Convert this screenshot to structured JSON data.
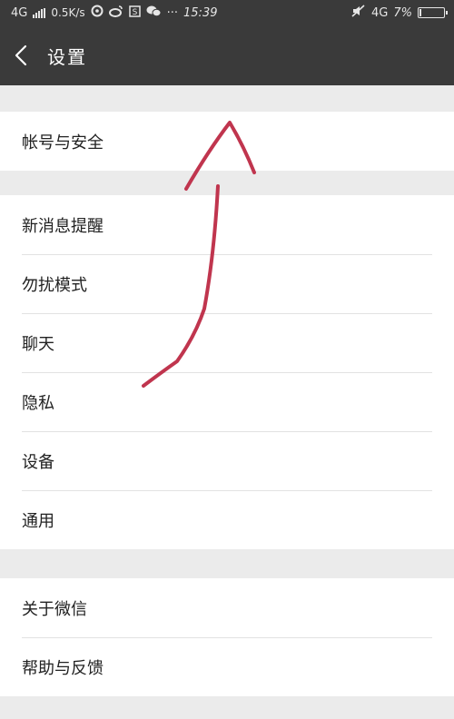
{
  "status_bar": {
    "network": "4G",
    "speed": "0.5K/s",
    "dots": "···",
    "time": "15:39",
    "network_right": "4G",
    "battery_text": "7%",
    "icons": [
      "signal-icon",
      "weibo-app-icon",
      "weibo-icon",
      "s-app-icon",
      "wechat-icon",
      "mute-icon",
      "battery-icon"
    ]
  },
  "header": {
    "title": "设置"
  },
  "groups": [
    {
      "items": [
        "帐号与安全"
      ]
    },
    {
      "items": [
        "新消息提醒",
        "勿扰模式",
        "聊天",
        "隐私",
        "设备",
        "通用"
      ]
    },
    {
      "items": [
        "关于微信",
        "帮助与反馈"
      ]
    }
  ],
  "colors": {
    "bar": "#3a3a3a",
    "page_bg": "#ebebeb",
    "row_bg": "#ffffff",
    "annotation": "#c0354e"
  }
}
